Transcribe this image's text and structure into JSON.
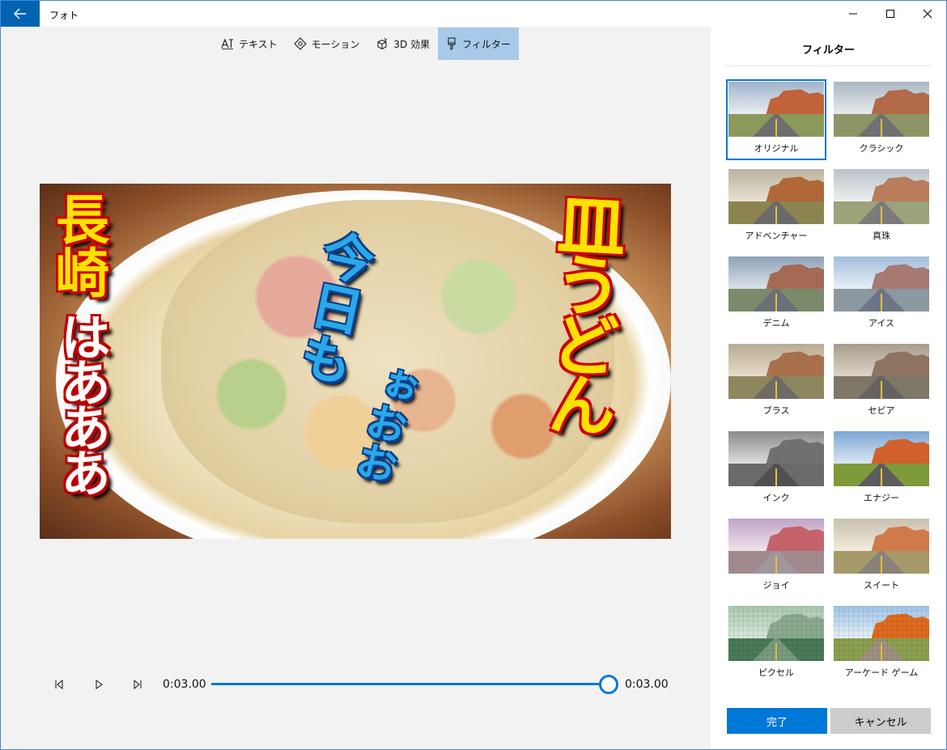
{
  "titlebar": {
    "app_title": "フォト"
  },
  "toolbar": {
    "items": [
      {
        "label": "テキスト",
        "icon": "text-icon"
      },
      {
        "label": "モーション",
        "icon": "motion-icon"
      },
      {
        "label": "3D 効果",
        "icon": "3d-effects-icon"
      },
      {
        "label": "フィルター",
        "icon": "filter-icon",
        "active": true
      }
    ]
  },
  "preview": {
    "text_left_yellow": "長崎",
    "text_left_white": "はあああ",
    "text_center_blue": "今日も",
    "text_center_small": "ぉおお",
    "text_right_yellow": "皿うどん"
  },
  "playback": {
    "current_time": "0:03.00",
    "total_time": "0:03.00",
    "progress": 1.0
  },
  "panel": {
    "title": "フィルター",
    "filters": [
      {
        "label": "オリジナル",
        "selected": true
      },
      {
        "label": "クラシック"
      },
      {
        "label": "アドベンチャー"
      },
      {
        "label": "真珠"
      },
      {
        "label": "デニム"
      },
      {
        "label": "アイス"
      },
      {
        "label": "ブラス"
      },
      {
        "label": "セピア"
      },
      {
        "label": "インク"
      },
      {
        "label": "エナジー"
      },
      {
        "label": "ジョイ"
      },
      {
        "label": "スイート"
      },
      {
        "label": "ピクセル"
      },
      {
        "label": "アーケード ゲーム"
      }
    ],
    "done_label": "完了",
    "cancel_label": "キャンセル"
  },
  "colors": {
    "accent": "#0078d7",
    "title_back": "#0063b1",
    "toolbar_active": "#a7c9ea"
  }
}
